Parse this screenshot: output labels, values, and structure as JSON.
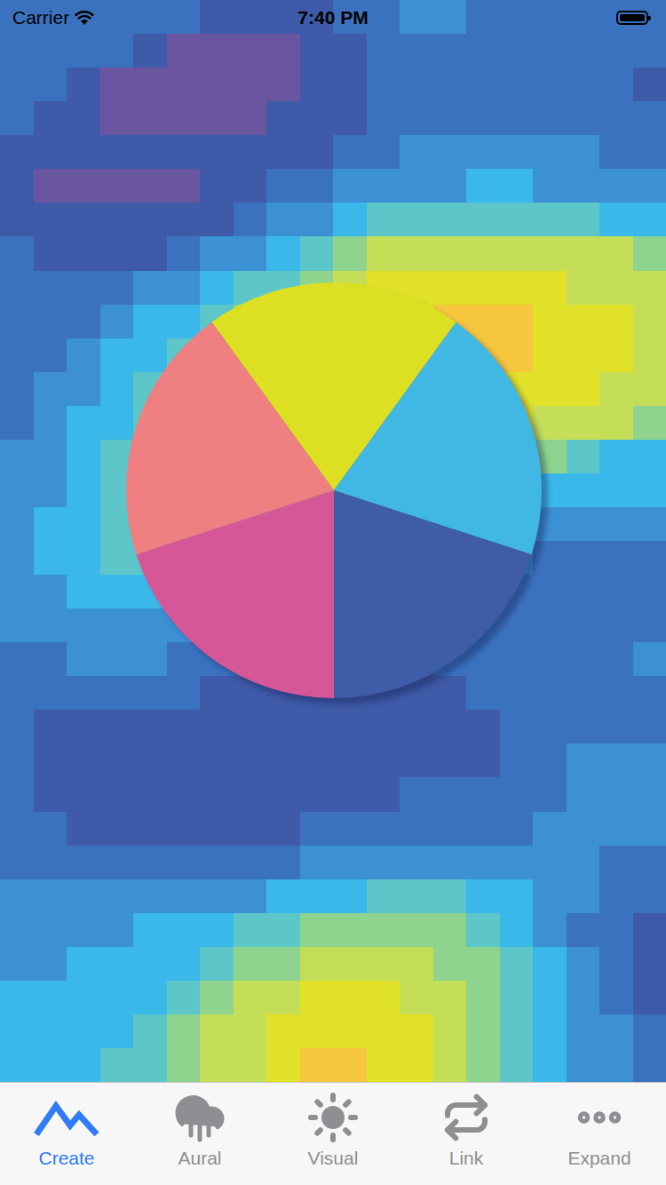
{
  "status_bar": {
    "carrier": "Carrier",
    "time": "7:40 PM",
    "wifi": true,
    "battery": {
      "level": 1
    }
  },
  "heatmap": {
    "rows": [
      [
        2,
        2,
        2,
        2,
        2,
        2,
        1,
        1,
        1,
        1,
        2,
        2,
        3,
        3,
        2,
        2,
        2,
        2,
        2,
        2
      ],
      [
        2,
        2,
        2,
        2,
        1,
        0,
        0,
        0,
        0,
        1,
        1,
        2,
        2,
        2,
        2,
        2,
        2,
        2,
        2,
        2
      ],
      [
        2,
        2,
        1,
        0,
        0,
        0,
        0,
        0,
        0,
        1,
        1,
        2,
        2,
        2,
        2,
        2,
        2,
        2,
        2,
        1
      ],
      [
        2,
        1,
        1,
        0,
        0,
        0,
        0,
        0,
        1,
        1,
        1,
        2,
        2,
        2,
        2,
        2,
        2,
        2,
        2,
        2
      ],
      [
        1,
        1,
        1,
        1,
        1,
        1,
        1,
        1,
        1,
        1,
        2,
        2,
        3,
        3,
        3,
        3,
        3,
        3,
        2,
        2
      ],
      [
        1,
        0,
        0,
        0,
        0,
        0,
        1,
        1,
        2,
        2,
        3,
        3,
        3,
        3,
        4,
        4,
        3,
        3,
        3,
        3
      ],
      [
        1,
        1,
        1,
        1,
        1,
        1,
        1,
        2,
        3,
        3,
        4,
        5,
        5,
        5,
        5,
        5,
        5,
        5,
        4,
        4
      ],
      [
        2,
        1,
        1,
        1,
        1,
        2,
        3,
        3,
        4,
        5,
        6,
        7,
        7,
        7,
        7,
        7,
        7,
        7,
        7,
        6
      ],
      [
        2,
        2,
        2,
        2,
        3,
        3,
        4,
        5,
        5,
        6,
        7,
        8,
        8,
        8,
        8,
        8,
        8,
        7,
        7,
        7
      ],
      [
        2,
        2,
        2,
        3,
        4,
        4,
        5,
        6,
        7,
        7,
        8,
        8,
        8,
        9,
        9,
        9,
        8,
        8,
        8,
        7
      ],
      [
        2,
        2,
        3,
        4,
        4,
        5,
        6,
        7,
        7,
        8,
        8,
        8,
        9,
        9,
        9,
        9,
        8,
        8,
        8,
        7
      ],
      [
        2,
        3,
        3,
        4,
        5,
        6,
        7,
        7,
        8,
        8,
        8,
        8,
        9,
        9,
        9,
        8,
        8,
        8,
        7,
        7
      ],
      [
        2,
        3,
        4,
        4,
        5,
        6,
        7,
        7,
        7,
        8,
        8,
        8,
        8,
        8,
        8,
        8,
        7,
        7,
        7,
        6
      ],
      [
        3,
        3,
        4,
        5,
        6,
        7,
        7,
        7,
        7,
        7,
        8,
        7,
        7,
        7,
        7,
        6,
        6,
        5,
        4,
        4
      ],
      [
        3,
        3,
        4,
        5,
        6,
        7,
        7,
        6,
        6,
        6,
        6,
        6,
        5,
        5,
        5,
        5,
        4,
        4,
        4,
        4
      ],
      [
        3,
        4,
        4,
        5,
        6,
        6,
        5,
        5,
        5,
        4,
        4,
        4,
        4,
        4,
        4,
        3,
        3,
        3,
        3,
        3
      ],
      [
        3,
        4,
        4,
        5,
        5,
        5,
        4,
        4,
        3,
        3,
        3,
        3,
        3,
        3,
        3,
        3,
        2,
        2,
        2,
        2
      ],
      [
        3,
        3,
        4,
        4,
        4,
        4,
        3,
        3,
        2,
        2,
        2,
        2,
        2,
        2,
        2,
        2,
        2,
        2,
        2,
        2
      ],
      [
        3,
        3,
        3,
        3,
        3,
        3,
        2,
        2,
        2,
        1,
        1,
        1,
        1,
        2,
        2,
        2,
        2,
        2,
        2,
        2
      ],
      [
        2,
        2,
        3,
        3,
        3,
        2,
        2,
        2,
        1,
        1,
        1,
        1,
        1,
        2,
        2,
        2,
        2,
        2,
        2,
        3
      ],
      [
        2,
        2,
        2,
        2,
        2,
        2,
        1,
        1,
        1,
        1,
        1,
        1,
        1,
        1,
        2,
        2,
        2,
        2,
        2,
        2
      ],
      [
        2,
        1,
        1,
        1,
        1,
        1,
        1,
        1,
        1,
        1,
        1,
        1,
        1,
        1,
        1,
        2,
        2,
        2,
        2,
        2
      ],
      [
        2,
        1,
        1,
        1,
        1,
        1,
        1,
        1,
        1,
        1,
        1,
        1,
        1,
        1,
        1,
        2,
        2,
        3,
        3,
        3
      ],
      [
        2,
        1,
        1,
        1,
        1,
        1,
        1,
        1,
        1,
        1,
        1,
        1,
        2,
        2,
        2,
        2,
        2,
        3,
        3,
        3
      ],
      [
        2,
        2,
        1,
        1,
        1,
        1,
        1,
        1,
        1,
        2,
        2,
        2,
        2,
        2,
        2,
        2,
        3,
        3,
        3,
        3
      ],
      [
        2,
        2,
        2,
        2,
        2,
        2,
        2,
        2,
        2,
        3,
        3,
        3,
        3,
        3,
        3,
        3,
        3,
        3,
        2,
        2
      ],
      [
        3,
        3,
        3,
        3,
        3,
        3,
        3,
        3,
        4,
        4,
        4,
        5,
        5,
        5,
        4,
        4,
        3,
        3,
        2,
        2
      ],
      [
        3,
        3,
        3,
        3,
        4,
        4,
        4,
        5,
        5,
        6,
        6,
        6,
        6,
        6,
        5,
        4,
        3,
        2,
        2,
        1
      ],
      [
        3,
        3,
        4,
        4,
        4,
        4,
        5,
        6,
        6,
        7,
        7,
        7,
        7,
        6,
        6,
        5,
        4,
        3,
        2,
        1
      ],
      [
        4,
        4,
        4,
        4,
        4,
        5,
        6,
        7,
        7,
        8,
        8,
        8,
        7,
        7,
        6,
        5,
        4,
        3,
        2,
        1
      ],
      [
        4,
        4,
        4,
        4,
        5,
        6,
        7,
        7,
        8,
        8,
        8,
        8,
        8,
        7,
        6,
        5,
        4,
        3,
        3,
        2
      ],
      [
        4,
        4,
        4,
        5,
        5,
        6,
        7,
        7,
        8,
        9,
        9,
        8,
        8,
        7,
        6,
        5,
        4,
        3,
        3,
        2
      ]
    ]
  },
  "wheel": {
    "segments": [
      {
        "value": 1,
        "color": "#dcdf22"
      },
      {
        "value": 1,
        "color": "#40b8e3"
      },
      {
        "value": 1,
        "color": "#3e5ca8"
      },
      {
        "value": 1,
        "color": "#d65797"
      },
      {
        "value": 1,
        "color": "#ef7f80"
      }
    ]
  },
  "tabs": [
    {
      "label": "Create",
      "selected": true
    },
    {
      "label": "Aural",
      "selected": false
    },
    {
      "label": "Visual",
      "selected": false
    },
    {
      "label": "Link",
      "selected": false
    },
    {
      "label": "Expand",
      "selected": false
    }
  ]
}
